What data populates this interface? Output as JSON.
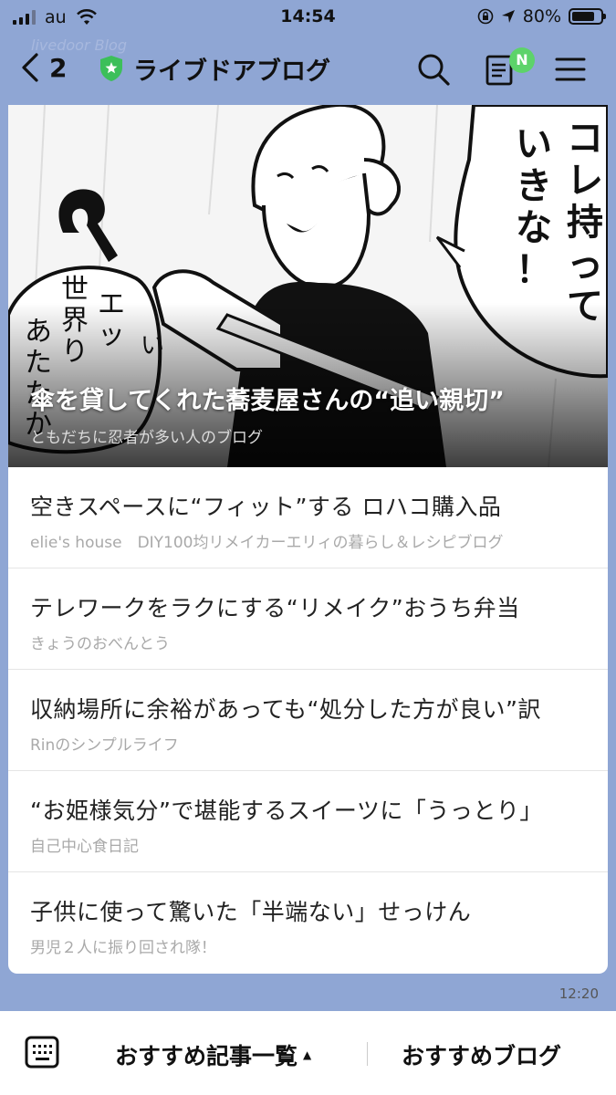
{
  "status_bar": {
    "carrier": "au",
    "time": "14:54",
    "battery": "80%",
    "battery_level": 0.8
  },
  "header": {
    "watermark": "livedoor Blog",
    "back_count": "2",
    "title": "ライブドアブログ",
    "news_badge": "N"
  },
  "featured": {
    "title": "傘を貸してくれた蕎麦屋さんの“追い親切”",
    "blog": "ともだちに忍者が多い人のブログ",
    "speech_bubble_right": [
      "コレ持って",
      "いきな！"
    ],
    "speech_bubble_left": [
      "エッ",
      "世界り",
      "あたたか"
    ]
  },
  "articles": [
    {
      "title": "空きスペースに“フィット”する ロハコ購入品",
      "blog": "elie's house　DIY100均リメイカーエリィの暮らし＆レシピブログ"
    },
    {
      "title": "テレワークをラクにする“リメイク”おうち弁当",
      "blog": "きょうのおべんとう"
    },
    {
      "title": "収納場所に余裕があっても“処分した方が良い”訳",
      "blog": "Rinのシンプルライフ"
    },
    {
      "title": "“お姫様気分”で堪能するスイーツに「うっとり」",
      "blog": "自己中心食日記"
    },
    {
      "title": "子供に使って驚いた「半端ない」せっけん",
      "blog": "男児２人に振り回され隊！"
    }
  ],
  "timestamp": "12:20",
  "bottom_bar": {
    "tab_recommended_articles": "おすすめ記事一覧",
    "caret": "▲",
    "tab_recommended_blogs": "おすすめブログ"
  }
}
